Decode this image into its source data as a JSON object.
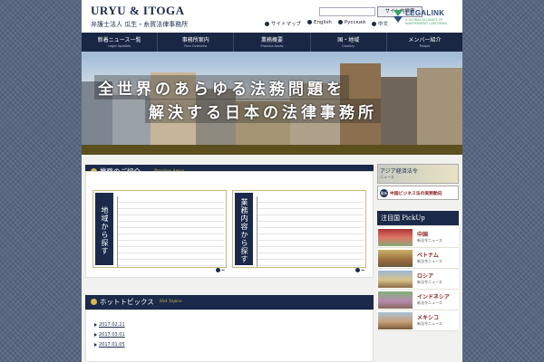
{
  "header": {
    "logo_main": "URYU & ITOGA",
    "logo_sub": "弁護士法人  瓜生・糸賀法律事務所",
    "search_button": "サイト内検索",
    "links": [
      "サイトマップ",
      "English",
      "Русский",
      "中文"
    ],
    "legalink_name": "LEGALINK",
    "legalink_sub": "A GLOBAL ALLIANCE OF INDEPENDENT LAW FIRMS"
  },
  "nav": [
    {
      "label": "新着ニュース一覧",
      "sub": "Legal Updates"
    },
    {
      "label": "事務所案内",
      "sub": "Firm Overview"
    },
    {
      "label": "業務概要",
      "sub": "Practice Areas"
    },
    {
      "label": "国・地域",
      "sub": "Country"
    },
    {
      "label": "メンバー紹介",
      "sub": "People"
    }
  ],
  "hero": {
    "line1": "全世界のあらゆる法務問題を",
    "line2": "解決する日本の法律事務所"
  },
  "practice": {
    "title": "業務のご紹介",
    "title_en": "Practice Areas",
    "card1_tab": "地域から探す",
    "card2_tab": "業務内容から探す"
  },
  "topics": {
    "title": "ホットトピックス",
    "title_en": "Hot Topics",
    "items": [
      "2017.02.21",
      "2017.03.01",
      "2017.01.05"
    ]
  },
  "sidebar": {
    "banner1_title": "アジア経済法令",
    "banner1_sub": "ニュース",
    "banner2_badge": "最新",
    "banner2_text": "中国ビジネス法の実務動向",
    "pickup_title": "注目国 PickUp",
    "pickup": [
      {
        "name": "中国",
        "sub": "新法令ニュース"
      },
      {
        "name": "ベトナム",
        "sub": "新法令ニュース"
      },
      {
        "name": "ロシア",
        "sub": "新法令ニュース"
      },
      {
        "name": "インドネシア",
        "sub": "新法令ニュース"
      },
      {
        "name": "メキシコ",
        "sub": "新法令ニュース"
      }
    ]
  },
  "colors": {
    "navy": "#1b2a4a",
    "gold": "#d8b84c",
    "accent_red": "#8a1e1e"
  }
}
